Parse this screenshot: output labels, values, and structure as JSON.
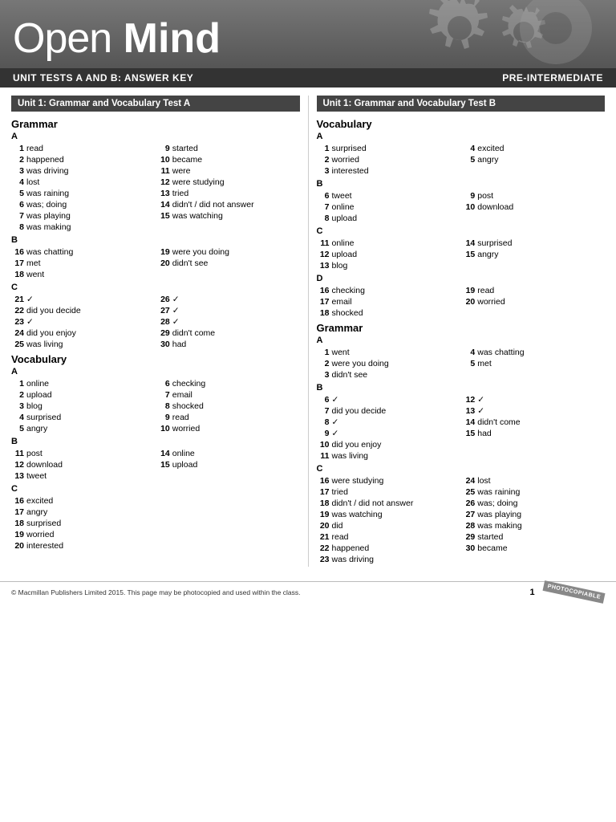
{
  "header": {
    "logo_open": "Open",
    "logo_mind": "Mind",
    "subheader_left": "UNIT TESTS A AND B: ANSWER KEY",
    "subheader_right": "PRE-INTERMEDIATE"
  },
  "left_column": {
    "unit_title": "Unit 1: Grammar and Vocabulary Test A",
    "grammar_section": "Grammar",
    "grammar_A_label": "A",
    "grammar_A": [
      {
        "num": "1",
        "val": "read"
      },
      {
        "num": "9",
        "val": "started"
      },
      {
        "num": "2",
        "val": "happened"
      },
      {
        "num": "10",
        "val": "became"
      },
      {
        "num": "3",
        "val": "was driving"
      },
      {
        "num": "11",
        "val": "were"
      },
      {
        "num": "4",
        "val": "lost"
      },
      {
        "num": "12",
        "val": "were studying"
      },
      {
        "num": "5",
        "val": "was raining"
      },
      {
        "num": "13",
        "val": "tried"
      },
      {
        "num": "6",
        "val": "was; doing"
      },
      {
        "num": "14",
        "val": "didn't / did not answer"
      },
      {
        "num": "7",
        "val": "was playing"
      },
      {
        "num": "15",
        "val": "was watching"
      },
      {
        "num": "8",
        "val": "was making"
      },
      {
        "num": "",
        "val": ""
      }
    ],
    "grammar_B_label": "B",
    "grammar_B": [
      {
        "num": "16",
        "val": "was chatting"
      },
      {
        "num": "19",
        "val": "were you doing"
      },
      {
        "num": "17",
        "val": "met"
      },
      {
        "num": "20",
        "val": "didn't see"
      },
      {
        "num": "18",
        "val": "went"
      },
      {
        "num": "",
        "val": ""
      }
    ],
    "grammar_C_label": "C",
    "grammar_C": [
      {
        "num": "21",
        "val": "✓"
      },
      {
        "num": "26",
        "val": "✓"
      },
      {
        "num": "22",
        "val": "did you decide"
      },
      {
        "num": "27",
        "val": "✓"
      },
      {
        "num": "23",
        "val": "✓"
      },
      {
        "num": "28",
        "val": "✓"
      },
      {
        "num": "24",
        "val": "did you enjoy"
      },
      {
        "num": "29",
        "val": "didn't come"
      },
      {
        "num": "25",
        "val": "was living"
      },
      {
        "num": "30",
        "val": "had"
      }
    ],
    "vocabulary_section": "Vocabulary",
    "vocab_A_label": "A",
    "vocab_A": [
      {
        "num": "1",
        "val": "online"
      },
      {
        "num": "6",
        "val": "checking"
      },
      {
        "num": "2",
        "val": "upload"
      },
      {
        "num": "7",
        "val": "email"
      },
      {
        "num": "3",
        "val": "blog"
      },
      {
        "num": "8",
        "val": "shocked"
      },
      {
        "num": "4",
        "val": "surprised"
      },
      {
        "num": "9",
        "val": "read"
      },
      {
        "num": "5",
        "val": "angry"
      },
      {
        "num": "10",
        "val": "worried"
      }
    ],
    "vocab_B_label": "B",
    "vocab_B": [
      {
        "num": "11",
        "val": "post"
      },
      {
        "num": "14",
        "val": "online"
      },
      {
        "num": "12",
        "val": "download"
      },
      {
        "num": "15",
        "val": "upload"
      },
      {
        "num": "13",
        "val": "tweet"
      },
      {
        "num": "",
        "val": ""
      }
    ],
    "vocab_C_label": "C",
    "vocab_C": [
      {
        "num": "16",
        "val": "excited"
      },
      {
        "num": "",
        "val": ""
      },
      {
        "num": "17",
        "val": "angry"
      },
      {
        "num": "",
        "val": ""
      },
      {
        "num": "18",
        "val": "surprised"
      },
      {
        "num": "",
        "val": ""
      },
      {
        "num": "19",
        "val": "worried"
      },
      {
        "num": "",
        "val": ""
      },
      {
        "num": "20",
        "val": "interested"
      },
      {
        "num": "",
        "val": ""
      }
    ]
  },
  "right_column": {
    "unit_title": "Unit 1: Grammar and Vocabulary Test B",
    "vocabulary_section": "Vocabulary",
    "vocab_A_label": "A",
    "vocab_A": [
      {
        "num": "1",
        "val": "surprised"
      },
      {
        "num": "4",
        "val": "excited"
      },
      {
        "num": "2",
        "val": "worried"
      },
      {
        "num": "5",
        "val": "angry"
      },
      {
        "num": "3",
        "val": "interested"
      },
      {
        "num": "",
        "val": ""
      }
    ],
    "vocab_B_label": "B",
    "vocab_B": [
      {
        "num": "6",
        "val": "tweet"
      },
      {
        "num": "9",
        "val": "post"
      },
      {
        "num": "7",
        "val": "online"
      },
      {
        "num": "10",
        "val": "download"
      },
      {
        "num": "8",
        "val": "upload"
      },
      {
        "num": "",
        "val": ""
      }
    ],
    "vocab_C_label": "C",
    "vocab_C": [
      {
        "num": "11",
        "val": "online"
      },
      {
        "num": "14",
        "val": "surprised"
      },
      {
        "num": "12",
        "val": "upload"
      },
      {
        "num": "15",
        "val": "angry"
      },
      {
        "num": "13",
        "val": "blog"
      },
      {
        "num": "",
        "val": ""
      }
    ],
    "vocab_D_label": "D",
    "vocab_D": [
      {
        "num": "16",
        "val": "checking"
      },
      {
        "num": "19",
        "val": "read"
      },
      {
        "num": "17",
        "val": "email"
      },
      {
        "num": "20",
        "val": "worried"
      },
      {
        "num": "18",
        "val": "shocked"
      },
      {
        "num": "",
        "val": ""
      }
    ],
    "grammar_section": "Grammar",
    "grammar_A_label": "A",
    "grammar_A": [
      {
        "num": "1",
        "val": "went"
      },
      {
        "num": "4",
        "val": "was chatting"
      },
      {
        "num": "2",
        "val": "were you doing"
      },
      {
        "num": "5",
        "val": "met"
      },
      {
        "num": "3",
        "val": "didn't see"
      },
      {
        "num": "",
        "val": ""
      }
    ],
    "grammar_B_label": "B",
    "grammar_B": [
      {
        "num": "6",
        "val": "✓"
      },
      {
        "num": "12",
        "val": "✓"
      },
      {
        "num": "7",
        "val": "did you decide"
      },
      {
        "num": "13",
        "val": "✓"
      },
      {
        "num": "8",
        "val": "✓"
      },
      {
        "num": "14",
        "val": "didn't come"
      },
      {
        "num": "9",
        "val": "✓"
      },
      {
        "num": "15",
        "val": "had"
      },
      {
        "num": "10",
        "val": "did you enjoy"
      },
      {
        "num": "",
        "val": ""
      },
      {
        "num": "11",
        "val": "was living"
      },
      {
        "num": "",
        "val": ""
      }
    ],
    "grammar_C_label": "C",
    "grammar_C": [
      {
        "num": "16",
        "val": "were studying"
      },
      {
        "num": "24",
        "val": "lost"
      },
      {
        "num": "17",
        "val": "tried"
      },
      {
        "num": "25",
        "val": "was raining"
      },
      {
        "num": "18",
        "val": "didn't / did not answer"
      },
      {
        "num": "26",
        "val": "was; doing"
      },
      {
        "num": "19",
        "val": "was watching"
      },
      {
        "num": "27",
        "val": "was playing"
      },
      {
        "num": "20",
        "val": "did"
      },
      {
        "num": "28",
        "val": "was making"
      },
      {
        "num": "21",
        "val": "read"
      },
      {
        "num": "29",
        "val": "started"
      },
      {
        "num": "22",
        "val": "happened"
      },
      {
        "num": "30",
        "val": "became"
      },
      {
        "num": "23",
        "val": "was driving"
      },
      {
        "num": "",
        "val": ""
      }
    ]
  },
  "footer": {
    "copyright": "© Macmillan Publishers Limited 2015. This page may be photocopied and used within the class.",
    "page_num": "1",
    "stamp": "PHOTOCOPIABLE"
  }
}
